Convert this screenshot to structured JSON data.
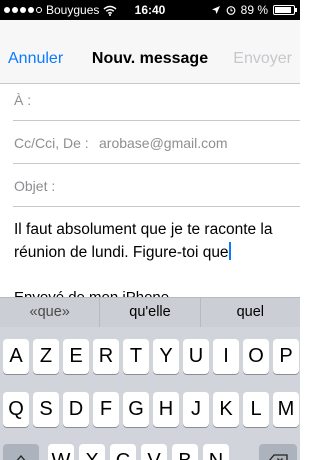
{
  "status_bar": {
    "carrier": "Bouygues",
    "time": "16:40",
    "battery_percent": "89 %",
    "battery_level": 0.89,
    "signal_icon": "signal-dots-icon",
    "wifi_icon": "wifi-icon",
    "location_icon": "location-arrow-icon",
    "alarm_icon": "alarm-clock-icon"
  },
  "nav": {
    "cancel_label": "Annuler",
    "title": "Nouv. message",
    "send_label": "Envoyer"
  },
  "fields": {
    "to_label": "À :",
    "cc_label": "Cc/Cci, De :",
    "from_value": "arobase@gmail.com",
    "subject_label": "Objet :"
  },
  "body": {
    "text": "Il faut absolument que je te raconte la réunion de lundi. Figure-toi que",
    "signature": "Envoyé de mon iPhone"
  },
  "suggestions": [
    "«que»",
    "qu'elle",
    "quel"
  ],
  "keyboard": {
    "row1": [
      "A",
      "Z",
      "E",
      "R",
      "T",
      "Y",
      "U",
      "I",
      "O",
      "P"
    ],
    "row2": [
      "Q",
      "S",
      "D",
      "F",
      "G",
      "H",
      "J",
      "K",
      "L",
      "M"
    ],
    "row3": [
      "W",
      "X",
      "C",
      "V",
      "B",
      "N"
    ],
    "shift_icon": "shift-arrow-icon",
    "delete_icon": "backspace-icon"
  },
  "colors": {
    "accent": "#0a7aff",
    "disabled": "#c7c7cc",
    "keyboard_bg": "#d1d5db"
  }
}
